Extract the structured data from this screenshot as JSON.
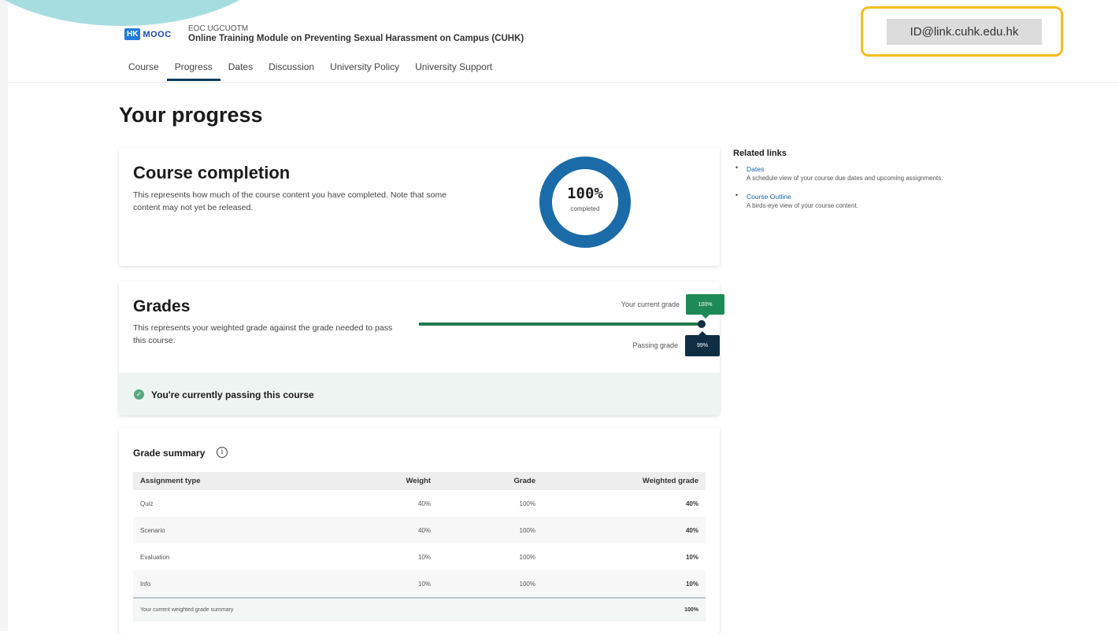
{
  "header": {
    "logo_box": "HK",
    "logo_text": "MOOC",
    "course_org": "EOC UGCUOTM",
    "course_title": "Online Training Module on Preventing Sexual Harassment on Campus (CUHK)",
    "user_id": "ID@link.cuhk.edu.hk",
    "highlight_color": "#f5bd1f"
  },
  "nav": {
    "tabs": [
      {
        "label": "Course"
      },
      {
        "label": "Progress",
        "active": true
      },
      {
        "label": "Dates"
      },
      {
        "label": "Discussion"
      },
      {
        "label": "University Policy"
      },
      {
        "label": "University Support"
      }
    ]
  },
  "page": {
    "heading": "Your progress"
  },
  "completion": {
    "title": "Course completion",
    "description": "This represents how much of the course content you have completed. Note that some content may not yet be released.",
    "percent_label": "100%",
    "percent_value": 1.0,
    "sub_label": "completed",
    "ring_color": "#1a6ba8"
  },
  "grades": {
    "title": "Grades",
    "description": "This represents your weighted grade against the grade needed to pass this course.",
    "current_label": "Your current grade",
    "current_value": "100%",
    "passing_label": "Passing grade",
    "passing_value": "99%",
    "status_text": "You're currently passing this course",
    "colors": {
      "current": "#1f8a55",
      "passing": "#0f2e44"
    }
  },
  "summary": {
    "title": "Grade summary",
    "columns": [
      "Assignment type",
      "Weight",
      "Grade",
      "Weighted grade"
    ],
    "rows": [
      [
        "Quiz",
        "40%",
        "100%",
        "40%"
      ],
      [
        "Scenario",
        "40%",
        "100%",
        "40%"
      ],
      [
        "Evaluation",
        "10%",
        "100%",
        "10%"
      ],
      [
        "Info",
        "10%",
        "100%",
        "10%"
      ]
    ],
    "footer_label": "Your current weighted grade summary",
    "footer_value": "100%"
  },
  "related": {
    "heading": "Related links",
    "items": [
      {
        "label": "Dates",
        "description": "A schedule view of your course due dates and upcoming assignments."
      },
      {
        "label": "Course Outline",
        "description": "A birds-eye view of your course content."
      }
    ]
  }
}
